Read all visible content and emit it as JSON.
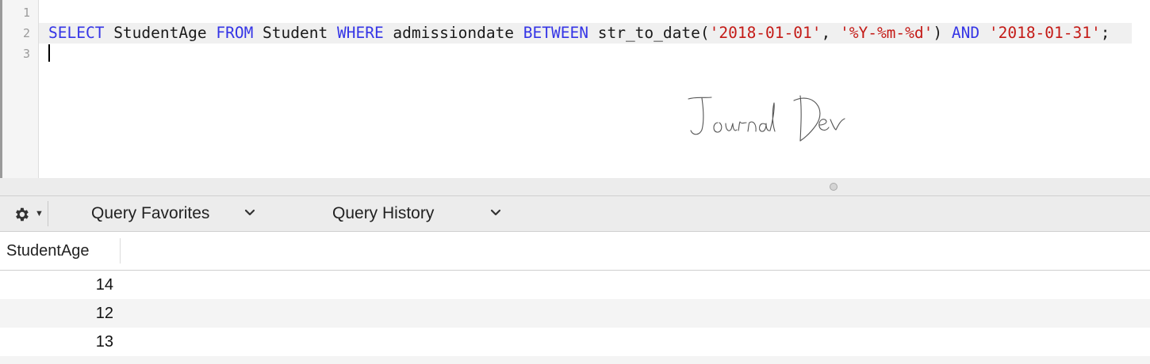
{
  "editor": {
    "line_numbers": [
      "1",
      "2",
      "3"
    ],
    "query_tokens": [
      {
        "text": "SELECT",
        "kind": "kw"
      },
      {
        "text": " StudentAge ",
        "kind": "ident"
      },
      {
        "text": "FROM",
        "kind": "kw"
      },
      {
        "text": " Student ",
        "kind": "ident"
      },
      {
        "text": "WHERE",
        "kind": "kw"
      },
      {
        "text": " admissiondate ",
        "kind": "ident"
      },
      {
        "text": "BETWEEN",
        "kind": "kw"
      },
      {
        "text": " str_to_date(",
        "kind": "ident"
      },
      {
        "text": "'2018-01-01'",
        "kind": "str"
      },
      {
        "text": ", ",
        "kind": "ident"
      },
      {
        "text": "'%Y-%m-%d'",
        "kind": "str"
      },
      {
        "text": ") ",
        "kind": "ident"
      },
      {
        "text": "AND",
        "kind": "kw"
      },
      {
        "text": " ",
        "kind": "ident"
      },
      {
        "text": "'2018-01-31'",
        "kind": "str"
      },
      {
        "text": ";",
        "kind": "ident"
      }
    ],
    "watermark": "JournalDev"
  },
  "toolbar": {
    "gear_icon": "gear-icon",
    "favorites_label": "Query Favorites",
    "history_label": "Query History"
  },
  "results": {
    "columns": [
      "StudentAge"
    ],
    "rows": [
      [
        "14"
      ],
      [
        "12"
      ],
      [
        "13"
      ]
    ]
  },
  "colors": {
    "keyword": "#3535e6",
    "string": "#c41a16",
    "active_line": "#f0f0f0",
    "alt_row": "#f4f4f4"
  }
}
